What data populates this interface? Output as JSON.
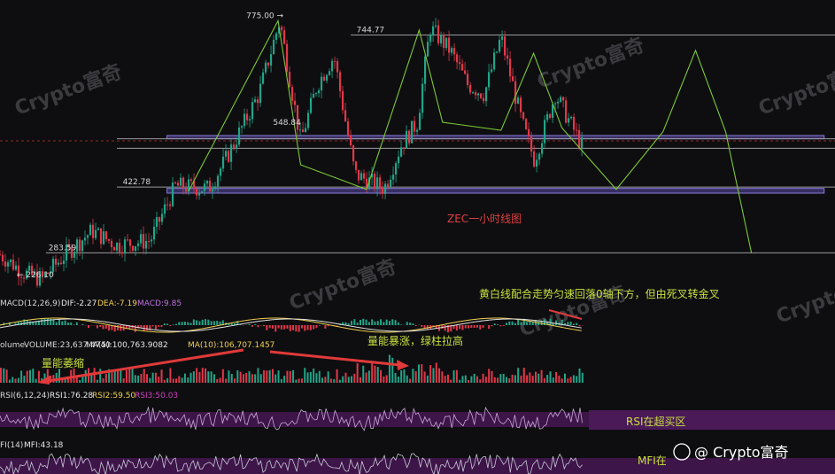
{
  "chart_data": {
    "type": "candlestick",
    "title": "ZEC一小时线图",
    "price_range": [
      200,
      800
    ],
    "price_levels": [
      {
        "label": "775.00",
        "value": 775.0
      },
      {
        "label": "744.77",
        "value": 744.77
      },
      {
        "label": "548.84",
        "value": 548.84
      },
      {
        "label": "422.78",
        "value": 422.78
      },
      {
        "label": "283.59",
        "value": 283.59
      },
      {
        "label": "226.10",
        "value": 226.1
      }
    ],
    "horizontal_lines": [
      744.77,
      525,
      505,
      422.78,
      283.59
    ],
    "zones": [
      {
        "from": 525,
        "to": 532
      },
      {
        "from": 410,
        "to": 420
      }
    ],
    "zigzag_price_path": [
      {
        "bar": 0.0,
        "price": 415
      },
      {
        "bar": 0.107,
        "price": 775
      },
      {
        "bar": 0.134,
        "price": 470
      },
      {
        "bar": 0.213,
        "price": 418
      },
      {
        "bar": 0.276,
        "price": 755
      },
      {
        "bar": 0.304,
        "price": 560
      },
      {
        "bar": 0.374,
        "price": 543
      },
      {
        "bar": 0.413,
        "price": 706
      },
      {
        "bar": 0.447,
        "price": 548
      },
      {
        "bar": 0.512,
        "price": 418
      },
      {
        "bar": 0.568,
        "price": 540
      },
      {
        "bar": 0.607,
        "price": 712
      },
      {
        "bar": 0.643,
        "price": 540
      },
      {
        "bar": 0.674,
        "price": 283
      }
    ],
    "indicators": {
      "macd": {
        "label": "MACD(12,26,9)",
        "dif": "DIF:-2.27",
        "dea": "DEA:-7.19",
        "macd": "MACD:9.85"
      },
      "volume": {
        "label": "olume",
        "volume": "VOLUME:23,637.4740",
        "ma5": "MA(5):100,763.9082",
        "ma10": "MA(10):106,707.1457"
      },
      "rsi": {
        "label": "RSI(6,12,24)",
        "rsi1": "RSI1:76.28",
        "rsi2": "RSI2:59.50",
        "rsi3": "RSI3:50.03"
      },
      "mfi": {
        "label": "FI(14)",
        "mfi": "MFI:43.18"
      }
    },
    "annotations": {
      "chart_title": "ZEC一小时线图",
      "macd_note": "黄白线配合走势匀速回落0轴下方，但由死叉转金叉",
      "volume_shrink": "量能萎缩",
      "volume_surge": "量能暴涨，绿柱拉高",
      "rsi_note": "RSI在超买区",
      "mfi_note": "MFI在"
    },
    "watermark": "Crypto富奇",
    "colors": {
      "up": "#22a488",
      "down": "#e0384a",
      "zigzag": "#7cc834",
      "zone": "#5a4aa8",
      "dif": "#f0d050",
      "dea": "#e0e0e0",
      "rsi_band": "#5e1f6e",
      "arrow": "#e03a3a",
      "annotation": "#c8e040"
    }
  }
}
